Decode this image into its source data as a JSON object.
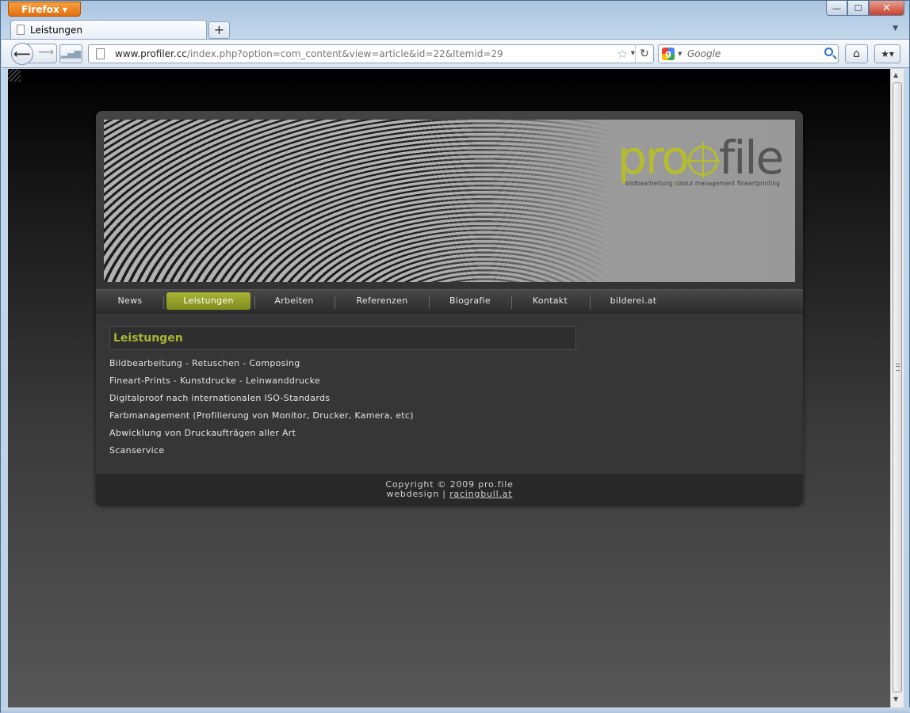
{
  "browser": {
    "app_button": "Firefox",
    "tab_title": "Leistungen",
    "url_host": "www.profiler.cc",
    "url_path": "/index.php?option=com_content&view=article&id=22&Itemid=29",
    "search_placeholder": "Google",
    "window_controls": {
      "minimize": "—",
      "maximize": "☐",
      "close": "✕"
    }
  },
  "site": {
    "logo": {
      "pro": "pro",
      "file": "file"
    },
    "tagline": {
      "a": "bildbearbeitung",
      "b": "colour management",
      "c": "fineartprinting"
    },
    "menu": [
      {
        "label": "News",
        "active": false
      },
      {
        "label": "Leistungen",
        "active": true
      },
      {
        "label": "Arbeiten",
        "active": false
      },
      {
        "label": "Referenzen",
        "active": false
      },
      {
        "label": "Biografie",
        "active": false
      },
      {
        "label": "Kontakt",
        "active": false
      },
      {
        "label": "bilderei.at",
        "active": false
      }
    ],
    "page_title": "Leistungen",
    "services": [
      "Bildbearbeitung - Retuschen - Composing",
      "Fineart-Prints - Kunstdrucke - Leinwanddrucke",
      "Digitalproof nach internationalen ISO-Standards",
      "Farbmanagement (Profilierung von Monitor, Drucker, Kamera, etc)",
      "Abwicklung von Druckaufträgen aller Art",
      "Scanservice"
    ],
    "footer": {
      "copyright": "Copyright © 2009 pro.file",
      "webdesign_prefix": "webdesign | ",
      "webdesign_link": "racingbull.at"
    },
    "colors": {
      "accent": "#a8b536",
      "background_top": "#000000",
      "panel": "#363636"
    }
  }
}
